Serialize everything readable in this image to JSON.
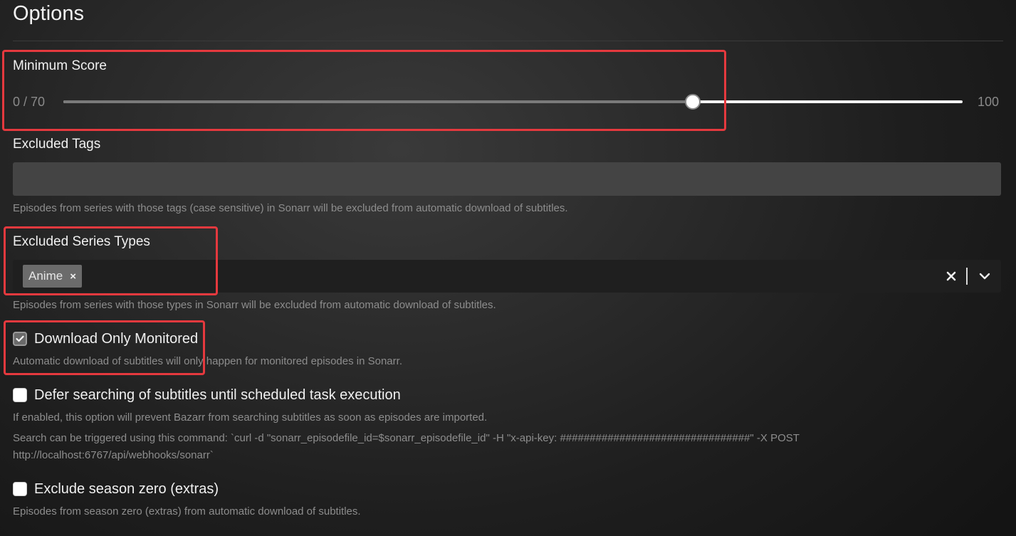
{
  "section": {
    "title": "Options"
  },
  "minimum_score": {
    "label": "Minimum Score",
    "min_text": "0 / 70",
    "max_text": "100",
    "value": 70,
    "max": 100
  },
  "excluded_tags": {
    "label": "Excluded Tags",
    "value": "",
    "description": "Episodes from series with those tags (case sensitive) in Sonarr will be excluded from automatic download of subtitles."
  },
  "excluded_series_types": {
    "label": "Excluded Series Types",
    "selected": [
      "Anime"
    ],
    "chip_remove_glyph": "×",
    "clear_icon": "close-icon",
    "dropdown_icon": "chevron-down-icon",
    "description": "Episodes from series with those types in Sonarr will be excluded from automatic download of subtitles."
  },
  "download_only_monitored": {
    "label": "Download Only Monitored",
    "checked": true,
    "description": "Automatic download of subtitles will only happen for monitored episodes in Sonarr."
  },
  "defer_searching": {
    "label": "Defer searching of subtitles until scheduled task execution",
    "checked": false,
    "description": "If enabled, this option will prevent Bazarr from searching subtitles as soon as episodes are imported.",
    "command_line_1": "Search can be triggered using this command: `curl -d \"sonarr_episodefile_id=$sonarr_episodefile_id\" -H \"x-api-key: ################################\" -X POST",
    "command_line_2": "http://localhost:6767/api/webhooks/sonarr`"
  },
  "exclude_season_zero": {
    "label": "Exclude season zero (extras)",
    "checked": false,
    "description": "Episodes from season zero (extras) from automatic download of subtitles."
  },
  "colors": {
    "highlight": "#e5393e",
    "slider_fill": "#7a7a7a",
    "slider_track": "#f2f2f2",
    "chip": "#6b6b6b"
  }
}
